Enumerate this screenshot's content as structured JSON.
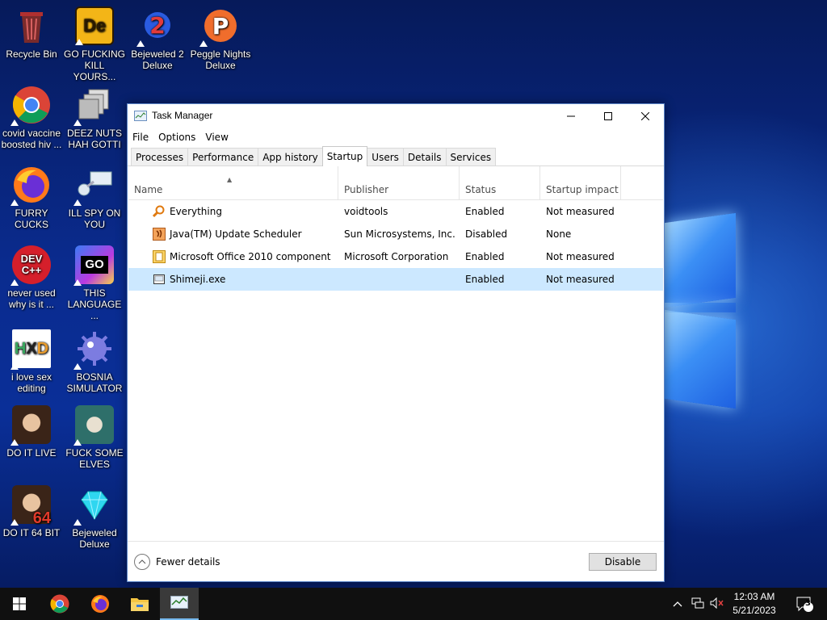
{
  "desktop": {
    "icons": [
      {
        "label": "Recycle Bin",
        "icon": "recycle-bin-icon"
      },
      {
        "label": "GO FUCKING KILL YOURS...",
        "icon": "de-app-icon"
      },
      {
        "label": "Bejeweled 2 Deluxe",
        "icon": "bejeweled2-icon"
      },
      {
        "label": "Peggle Nights Deluxe",
        "icon": "peggle-icon"
      },
      {
        "label": "covid vaccine boosted hiv ...",
        "icon": "chrome-icon"
      },
      {
        "label": "DEEZ NUTS HAH GOTTI",
        "icon": "windows-stack-icon"
      },
      {
        "label": "FURRY CUCKS",
        "icon": "firefox-icon"
      },
      {
        "label": "ILL SPY ON YOU",
        "icon": "network-spy-icon"
      },
      {
        "label": "never used why is it ...",
        "icon": "devcpp-icon"
      },
      {
        "label": "THIS LANGUAGE ...",
        "icon": "goland-icon"
      },
      {
        "label": "i love sex editing",
        "icon": "hxd-icon"
      },
      {
        "label": "BOSNIA SIMULATOR",
        "icon": "mine-icon"
      },
      {
        "label": "DO IT LIVE",
        "icon": "portrait-icon"
      },
      {
        "label": "FUCK SOME ELVES",
        "icon": "elf-portrait-icon"
      },
      {
        "label": "DO IT 64 BIT",
        "icon": "portrait-64-icon"
      },
      {
        "label": "Bejeweled Deluxe",
        "icon": "diamond-icon"
      }
    ]
  },
  "taskmanager": {
    "title": "Task Manager",
    "menu": [
      "File",
      "Options",
      "View"
    ],
    "tabs": [
      "Processes",
      "Performance",
      "App history",
      "Startup",
      "Users",
      "Details",
      "Services"
    ],
    "active_tab": "Startup",
    "columns": [
      "Name",
      "Publisher",
      "Status",
      "Startup impact"
    ],
    "rows": [
      {
        "name": "Everything",
        "publisher": "voidtools",
        "status": "Enabled",
        "impact": "Not measured",
        "icon": "magnifier-icon"
      },
      {
        "name": "Java(TM) Update Scheduler",
        "publisher": "Sun Microsystems, Inc.",
        "status": "Disabled",
        "impact": "None",
        "icon": "java-icon"
      },
      {
        "name": "Microsoft Office 2010 component",
        "publisher": "Microsoft Corporation",
        "status": "Enabled",
        "impact": "Not measured",
        "icon": "office-icon"
      },
      {
        "name": "Shimeji.exe",
        "publisher": "",
        "status": "Enabled",
        "impact": "Not measured",
        "icon": "exe-icon"
      }
    ],
    "selected_row": 3,
    "fewer_details": "Fewer details",
    "disable_button": "Disable"
  },
  "taskbar": {
    "pinned": [
      "windows-start-icon",
      "chrome-icon",
      "firefox-icon",
      "file-explorer-icon",
      "task-manager-icon"
    ],
    "time": "12:03 AM",
    "date": "5/21/2023",
    "notification_count": "3"
  }
}
